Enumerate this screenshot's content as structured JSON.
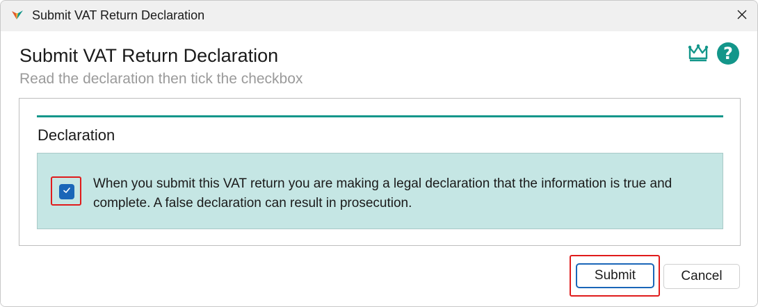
{
  "window": {
    "title": "Submit VAT Return Declaration"
  },
  "header": {
    "title": "Submit VAT Return Declaration",
    "subtitle": "Read the declaration then tick the checkbox"
  },
  "icons": {
    "app": "app-logo-icon",
    "close": "close-icon",
    "crown": "crown-icon",
    "help": "help-icon",
    "check": "checkmark-icon"
  },
  "panel": {
    "title": "Declaration",
    "checkbox_checked": true,
    "declaration_text": "When you submit this VAT return you are making a legal declaration that the information is true and complete. A false declaration can result in prosecution."
  },
  "buttons": {
    "submit": "Submit",
    "cancel": "Cancel"
  },
  "colors": {
    "accent": "#13968a",
    "declaration_background": "#c5e6e4",
    "checkbox": "#1a66b8",
    "highlight": "#e01b1b"
  }
}
